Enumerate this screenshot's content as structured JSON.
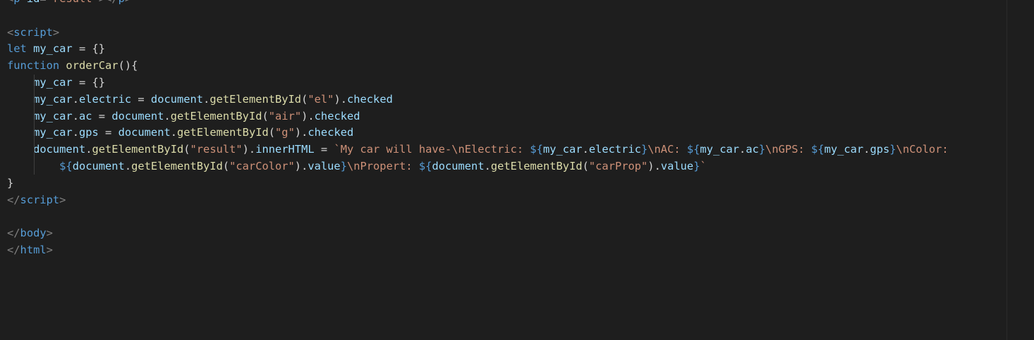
{
  "editor": {
    "lines": [
      [
        [
          "punc",
          "<"
        ],
        [
          "tag",
          "p"
        ],
        [
          "plain",
          " "
        ],
        [
          "attr",
          "id"
        ],
        [
          "plain",
          "="
        ],
        [
          "str",
          "\"result\""
        ],
        [
          "punc",
          ">"
        ],
        [
          "punc",
          "</"
        ],
        [
          "tag",
          "p"
        ],
        [
          "punc",
          ">"
        ]
      ],
      [],
      [
        [
          "punc",
          "<"
        ],
        [
          "tag",
          "script"
        ],
        [
          "punc",
          ">"
        ]
      ],
      [
        [
          "kw",
          "let"
        ],
        [
          "plain",
          " "
        ],
        [
          "var",
          "my_car"
        ],
        [
          "plain",
          " = {}"
        ]
      ],
      [
        [
          "kw",
          "function"
        ],
        [
          "plain",
          " "
        ],
        [
          "fn",
          "orderCar"
        ],
        [
          "plain",
          "(){"
        ]
      ],
      [
        [
          "plain",
          "    "
        ],
        [
          "var",
          "my_car"
        ],
        [
          "plain",
          " = {}"
        ]
      ],
      [
        [
          "plain",
          "    "
        ],
        [
          "var",
          "my_car"
        ],
        [
          "plain",
          "."
        ],
        [
          "var",
          "electric"
        ],
        [
          "plain",
          " = "
        ],
        [
          "var",
          "document"
        ],
        [
          "plain",
          "."
        ],
        [
          "fn",
          "getElementById"
        ],
        [
          "plain",
          "("
        ],
        [
          "str",
          "\"el\""
        ],
        [
          "plain",
          ")."
        ],
        [
          "var",
          "checked"
        ]
      ],
      [
        [
          "plain",
          "    "
        ],
        [
          "var",
          "my_car"
        ],
        [
          "plain",
          "."
        ],
        [
          "var",
          "ac"
        ],
        [
          "plain",
          " = "
        ],
        [
          "var",
          "document"
        ],
        [
          "plain",
          "."
        ],
        [
          "fn",
          "getElementById"
        ],
        [
          "plain",
          "("
        ],
        [
          "str",
          "\"air\""
        ],
        [
          "plain",
          ")."
        ],
        [
          "var",
          "checked"
        ]
      ],
      [
        [
          "plain",
          "    "
        ],
        [
          "var",
          "my_car"
        ],
        [
          "plain",
          "."
        ],
        [
          "var",
          "gps"
        ],
        [
          "plain",
          " = "
        ],
        [
          "var",
          "document"
        ],
        [
          "plain",
          "."
        ],
        [
          "fn",
          "getElementById"
        ],
        [
          "plain",
          "("
        ],
        [
          "str",
          "\"g\""
        ],
        [
          "plain",
          ")."
        ],
        [
          "var",
          "checked"
        ]
      ],
      [
        [
          "plain",
          "    "
        ],
        [
          "var",
          "document"
        ],
        [
          "plain",
          "."
        ],
        [
          "fn",
          "getElementById"
        ],
        [
          "plain",
          "("
        ],
        [
          "str",
          "\"result\""
        ],
        [
          "plain",
          ")."
        ],
        [
          "var",
          "innerHTML"
        ],
        [
          "plain",
          " = "
        ],
        [
          "str",
          "`My car will have-\\nElectric: "
        ],
        [
          "kw",
          "${"
        ],
        [
          "var",
          "my_car"
        ],
        [
          "plain",
          "."
        ],
        [
          "var",
          "electric"
        ],
        [
          "kw",
          "}"
        ],
        [
          "str",
          "\\nAC: "
        ],
        [
          "kw",
          "${"
        ],
        [
          "var",
          "my_car"
        ],
        [
          "plain",
          "."
        ],
        [
          "var",
          "ac"
        ],
        [
          "kw",
          "}"
        ],
        [
          "str",
          "\\nGPS: "
        ],
        [
          "kw",
          "${"
        ],
        [
          "var",
          "my_car"
        ],
        [
          "plain",
          "."
        ],
        [
          "var",
          "gps"
        ],
        [
          "kw",
          "}"
        ],
        [
          "str",
          "\\nColor:"
        ]
      ],
      [
        [
          "plain",
          "        "
        ],
        [
          "kw",
          "${"
        ],
        [
          "var",
          "document"
        ],
        [
          "plain",
          "."
        ],
        [
          "fn",
          "getElementById"
        ],
        [
          "plain",
          "("
        ],
        [
          "str",
          "\"carColor\""
        ],
        [
          "plain",
          ")."
        ],
        [
          "var",
          "value"
        ],
        [
          "kw",
          "}"
        ],
        [
          "str",
          "\\nPropert: "
        ],
        [
          "kw",
          "${"
        ],
        [
          "var",
          "document"
        ],
        [
          "plain",
          "."
        ],
        [
          "fn",
          "getElementById"
        ],
        [
          "plain",
          "("
        ],
        [
          "str",
          "\"carProp\""
        ],
        [
          "plain",
          ")."
        ],
        [
          "var",
          "value"
        ],
        [
          "kw",
          "}"
        ],
        [
          "str",
          "`"
        ]
      ],
      [
        [
          "plain",
          "}"
        ]
      ],
      [
        [
          "punc",
          "</"
        ],
        [
          "tag",
          "script"
        ],
        [
          "punc",
          ">"
        ]
      ],
      [],
      [
        [
          "punc",
          "</"
        ],
        [
          "tag",
          "body"
        ],
        [
          "punc",
          ">"
        ]
      ],
      [
        [
          "punc",
          "</"
        ],
        [
          "tag",
          "html"
        ],
        [
          "punc",
          ">"
        ]
      ]
    ]
  }
}
